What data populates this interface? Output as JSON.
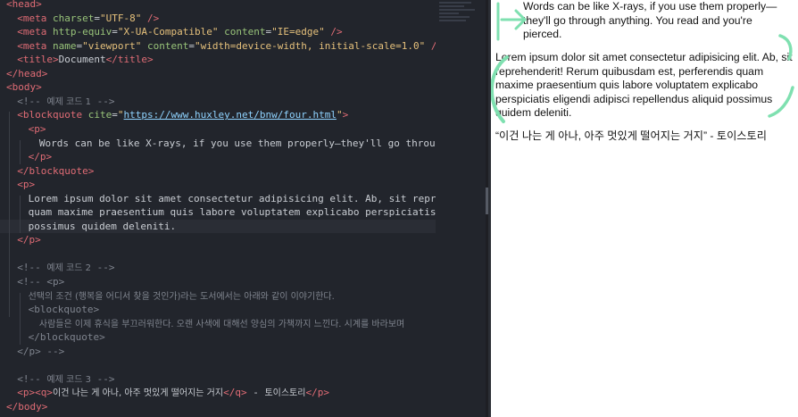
{
  "editor": {
    "lines": [
      {
        "indent": 0,
        "segs": [
          [
            "tag",
            "<head>"
          ]
        ]
      },
      {
        "indent": 1,
        "segs": [
          [
            "tag",
            "<meta "
          ],
          [
            "attr",
            "charset"
          ],
          [
            "punct",
            "="
          ],
          [
            "str",
            "\"UTF-8\""
          ],
          [
            "tag",
            " />"
          ]
        ]
      },
      {
        "indent": 1,
        "segs": [
          [
            "tag",
            "<meta "
          ],
          [
            "attr",
            "http-equiv"
          ],
          [
            "punct",
            "="
          ],
          [
            "str",
            "\"X-UA-Compatible\""
          ],
          [
            "attr",
            " content"
          ],
          [
            "punct",
            "="
          ],
          [
            "str",
            "\"IE=edge\""
          ],
          [
            "tag",
            " />"
          ]
        ]
      },
      {
        "indent": 1,
        "segs": [
          [
            "tag",
            "<meta "
          ],
          [
            "attr",
            "name"
          ],
          [
            "punct",
            "="
          ],
          [
            "str",
            "\"viewport\""
          ],
          [
            "attr",
            " content"
          ],
          [
            "punct",
            "="
          ],
          [
            "str",
            "\"width=device-width, initial-scale=1.0\""
          ],
          [
            "tag",
            " />"
          ]
        ]
      },
      {
        "indent": 1,
        "segs": [
          [
            "tag",
            "<title>"
          ],
          [
            "txt",
            "Document"
          ],
          [
            "tag",
            "</title>"
          ]
        ]
      },
      {
        "indent": 0,
        "segs": [
          [
            "tag",
            "</head>"
          ]
        ]
      },
      {
        "indent": 0,
        "segs": [
          [
            "tag",
            "<body>"
          ]
        ]
      },
      {
        "indent": 1,
        "segs": [
          [
            "com",
            "<!-- "
          ],
          [
            "comkr",
            "예제 코드 1"
          ],
          [
            "com",
            " -->"
          ]
        ]
      },
      {
        "indent": 1,
        "segs": [
          [
            "tag",
            "<blockquote "
          ],
          [
            "attr",
            "cite"
          ],
          [
            "punct",
            "="
          ],
          [
            "str",
            "\""
          ],
          [
            "url",
            "https://www.huxley.net/bnw/four.html"
          ],
          [
            "str",
            "\""
          ],
          [
            "tag",
            ">"
          ]
        ]
      },
      {
        "indent": 2,
        "segs": [
          [
            "tag",
            "<p>"
          ]
        ]
      },
      {
        "indent": 3,
        "segs": [
          [
            "txt",
            "Words can be like X-rays, if you use them properly—they'll go through a"
          ]
        ]
      },
      {
        "indent": 2,
        "segs": [
          [
            "tag",
            "</p>"
          ]
        ]
      },
      {
        "indent": 1,
        "segs": [
          [
            "tag",
            "</blockquote>"
          ]
        ]
      },
      {
        "indent": 1,
        "segs": [
          [
            "tag",
            "<p>"
          ]
        ]
      },
      {
        "indent": 2,
        "segs": [
          [
            "txt",
            "Lorem ipsum dolor sit amet consectetur adipisicing elit. Ab, sit reprehen"
          ]
        ]
      },
      {
        "indent": 2,
        "segs": [
          [
            "txt",
            "quam maxime praesentium quis labore voluptatem explicabo perspiciatis eli"
          ]
        ]
      },
      {
        "indent": 2,
        "segs": [
          [
            "txt",
            "possimus quidem deleniti."
          ]
        ],
        "highlight": true
      },
      {
        "indent": 1,
        "segs": [
          [
            "tag",
            "</p>"
          ]
        ]
      },
      {
        "indent": 0,
        "segs": []
      },
      {
        "indent": 1,
        "segs": [
          [
            "com",
            "<!-- "
          ],
          [
            "comkr",
            "예제 코드 2"
          ],
          [
            "com",
            " -->"
          ]
        ]
      },
      {
        "indent": 1,
        "segs": [
          [
            "com",
            "<!-- <p>"
          ]
        ]
      },
      {
        "indent": 2,
        "segs": [
          [
            "comkr",
            "선택의 조건 (행복을 어디서 찾을 것인가)라는 도서에서는 아래와 같이 이야기한다."
          ]
        ]
      },
      {
        "indent": 2,
        "segs": [
          [
            "com",
            "<blockquote>"
          ]
        ]
      },
      {
        "indent": 3,
        "segs": [
          [
            "comkr",
            "사람들은 이제 휴식을 부끄러워한다. 오랜 사색에 대해선 양심의 가책까지 느낀다. 시계를 바라보며"
          ]
        ]
      },
      {
        "indent": 2,
        "segs": [
          [
            "com",
            "</blockquote>"
          ]
        ]
      },
      {
        "indent": 1,
        "segs": [
          [
            "com",
            "</p> -->"
          ]
        ]
      },
      {
        "indent": 0,
        "segs": []
      },
      {
        "indent": 1,
        "segs": [
          [
            "com",
            "<!-- "
          ],
          [
            "comkr",
            "예제 코드 3"
          ],
          [
            "com",
            " -->"
          ]
        ]
      },
      {
        "indent": 1,
        "segs": [
          [
            "tag",
            "<p><q>"
          ],
          [
            "txtkr",
            "이건 나는 게 아나, 아주 멋있게 떨어지는 거지"
          ],
          [
            "tag",
            "</q>"
          ],
          [
            "txt",
            " - "
          ],
          [
            "txtkr",
            "토이스토리"
          ],
          [
            "tag",
            "</p>"
          ]
        ]
      },
      {
        "indent": 0,
        "segs": [
          [
            "tag",
            "</body>"
          ]
        ]
      }
    ]
  },
  "preview": {
    "quote": "Words can be like X-rays, if you use them properly—they'll go through anything. You read and you're pierced.",
    "lorem": "Lorem ipsum dolor sit amet consectetur adipisicing elit. Ab, sit reprehenderit! Rerum quibusdam est, perferendis quam maxime praesentium quis labore voluptatem explicabo perspiciatis eligendi adipisci repellendus aliquid possimus quidem deleniti.",
    "q3": "“이건 나는 게 아나, 아주 멋있게 떨어지는 거지” - 토이스토리"
  },
  "colors": {
    "editor_bg": "#22252c",
    "tag": "#e06c75",
    "attr": "#98c379",
    "string": "#e5c07b",
    "comment": "#7f848e",
    "annotation_ink": "#7fe0b0"
  }
}
